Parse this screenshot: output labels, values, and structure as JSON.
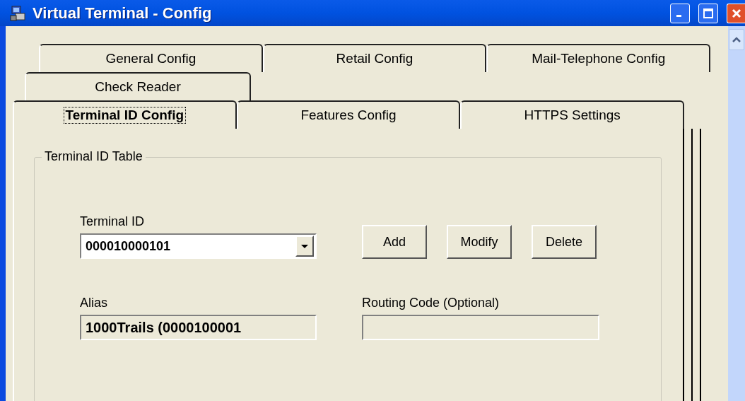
{
  "window": {
    "title": "Virtual Terminal - Config"
  },
  "tab_rows": [
    {
      "tabs": [
        {
          "label": "General Config",
          "selected": false
        },
        {
          "label": "Retail Config",
          "selected": false
        },
        {
          "label": "Mail-Telephone Config",
          "selected": false
        }
      ]
    },
    {
      "tabs": [
        {
          "label": "Check Reader",
          "selected": false
        }
      ]
    },
    {
      "tabs": [
        {
          "label": "Terminal ID Config",
          "selected": true
        },
        {
          "label": "Features Config",
          "selected": false
        },
        {
          "label": "HTTPS Settings",
          "selected": false
        }
      ]
    }
  ],
  "group": {
    "title": "Terminal ID Table",
    "terminal_id": {
      "label": "Terminal ID",
      "value": "000010000101"
    },
    "buttons": [
      "Add",
      "Modify",
      "Delete"
    ],
    "alias": {
      "label": "Alias",
      "value": "1000Trails (0000100001",
      "disabled": true
    },
    "routing_code": {
      "label": "Routing Code (Optional)",
      "disabled": true
    }
  }
}
